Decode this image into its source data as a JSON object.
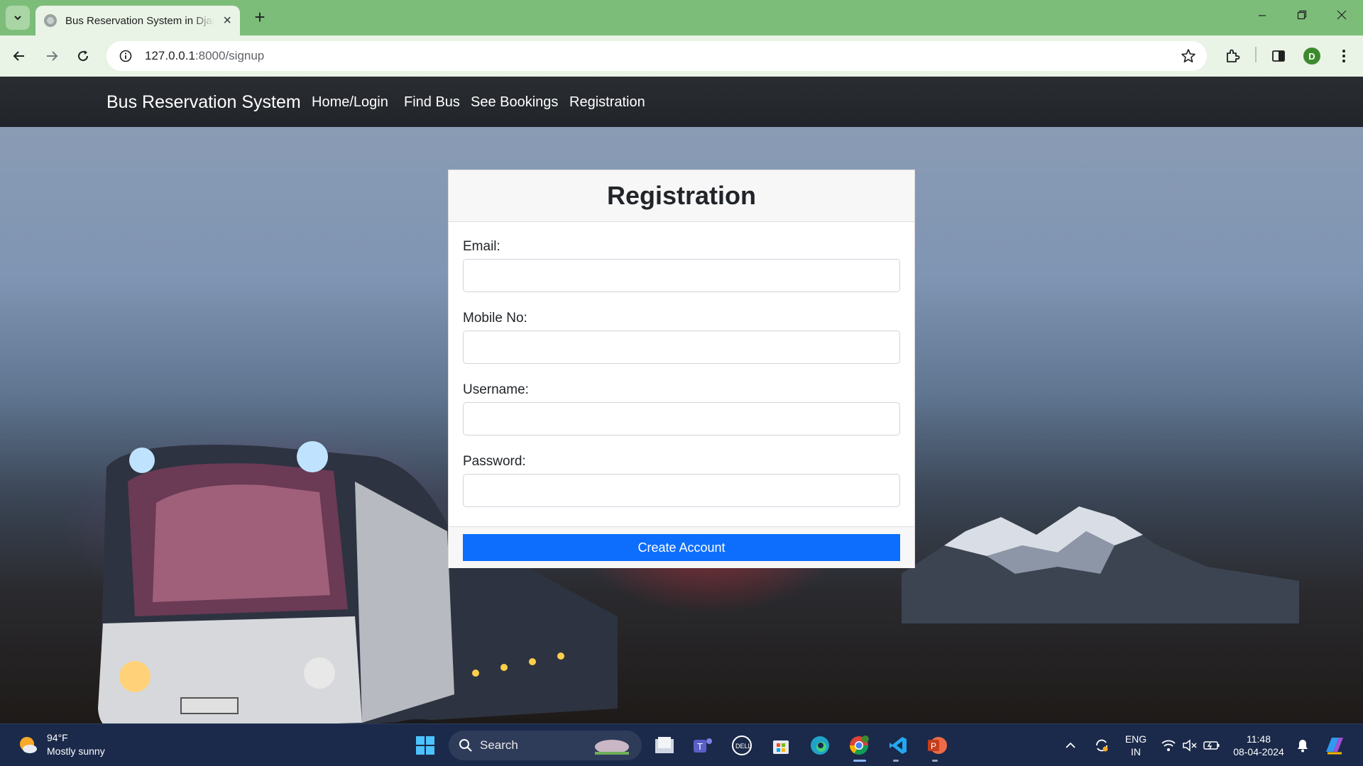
{
  "browser": {
    "tab_title": "Bus Reservation System in Django",
    "url_host": "127.0.0.1",
    "url_path": ":8000/signup",
    "profile_initial": "D"
  },
  "navbar": {
    "brand": "Bus Reservation System",
    "links": [
      "Home/Login",
      "Find Bus",
      "See Bookings",
      "Registration"
    ]
  },
  "form": {
    "title": "Registration",
    "fields": [
      {
        "label": "Email:",
        "value": ""
      },
      {
        "label": "Mobile No:",
        "value": ""
      },
      {
        "label": "Username:",
        "value": ""
      },
      {
        "label": "Password:",
        "value": ""
      }
    ],
    "submit_label": "Create Account",
    "primary_color": "#0d6efd"
  },
  "taskbar": {
    "temperature": "94°F",
    "weather": "Mostly sunny",
    "search_label": "Search",
    "lang_line1": "ENG",
    "lang_line2": "IN",
    "time": "11:48",
    "date": "08-04-2024"
  },
  "icons": [
    "tab-search-icon",
    "close-icon",
    "plus-icon",
    "back-icon",
    "forward-icon",
    "reload-icon",
    "site-info-icon",
    "star-icon",
    "extensions-icon",
    "sidepanel-icon",
    "menu-icon",
    "windows-start-icon",
    "search-icon",
    "file-explorer-icon",
    "teams-icon",
    "dell-icon",
    "store-icon",
    "edge-icon",
    "chrome-icon",
    "vscode-icon",
    "powerpoint-icon",
    "wifi-icon",
    "mute-icon",
    "battery-icon",
    "bell-icon",
    "copilot-icon"
  ]
}
